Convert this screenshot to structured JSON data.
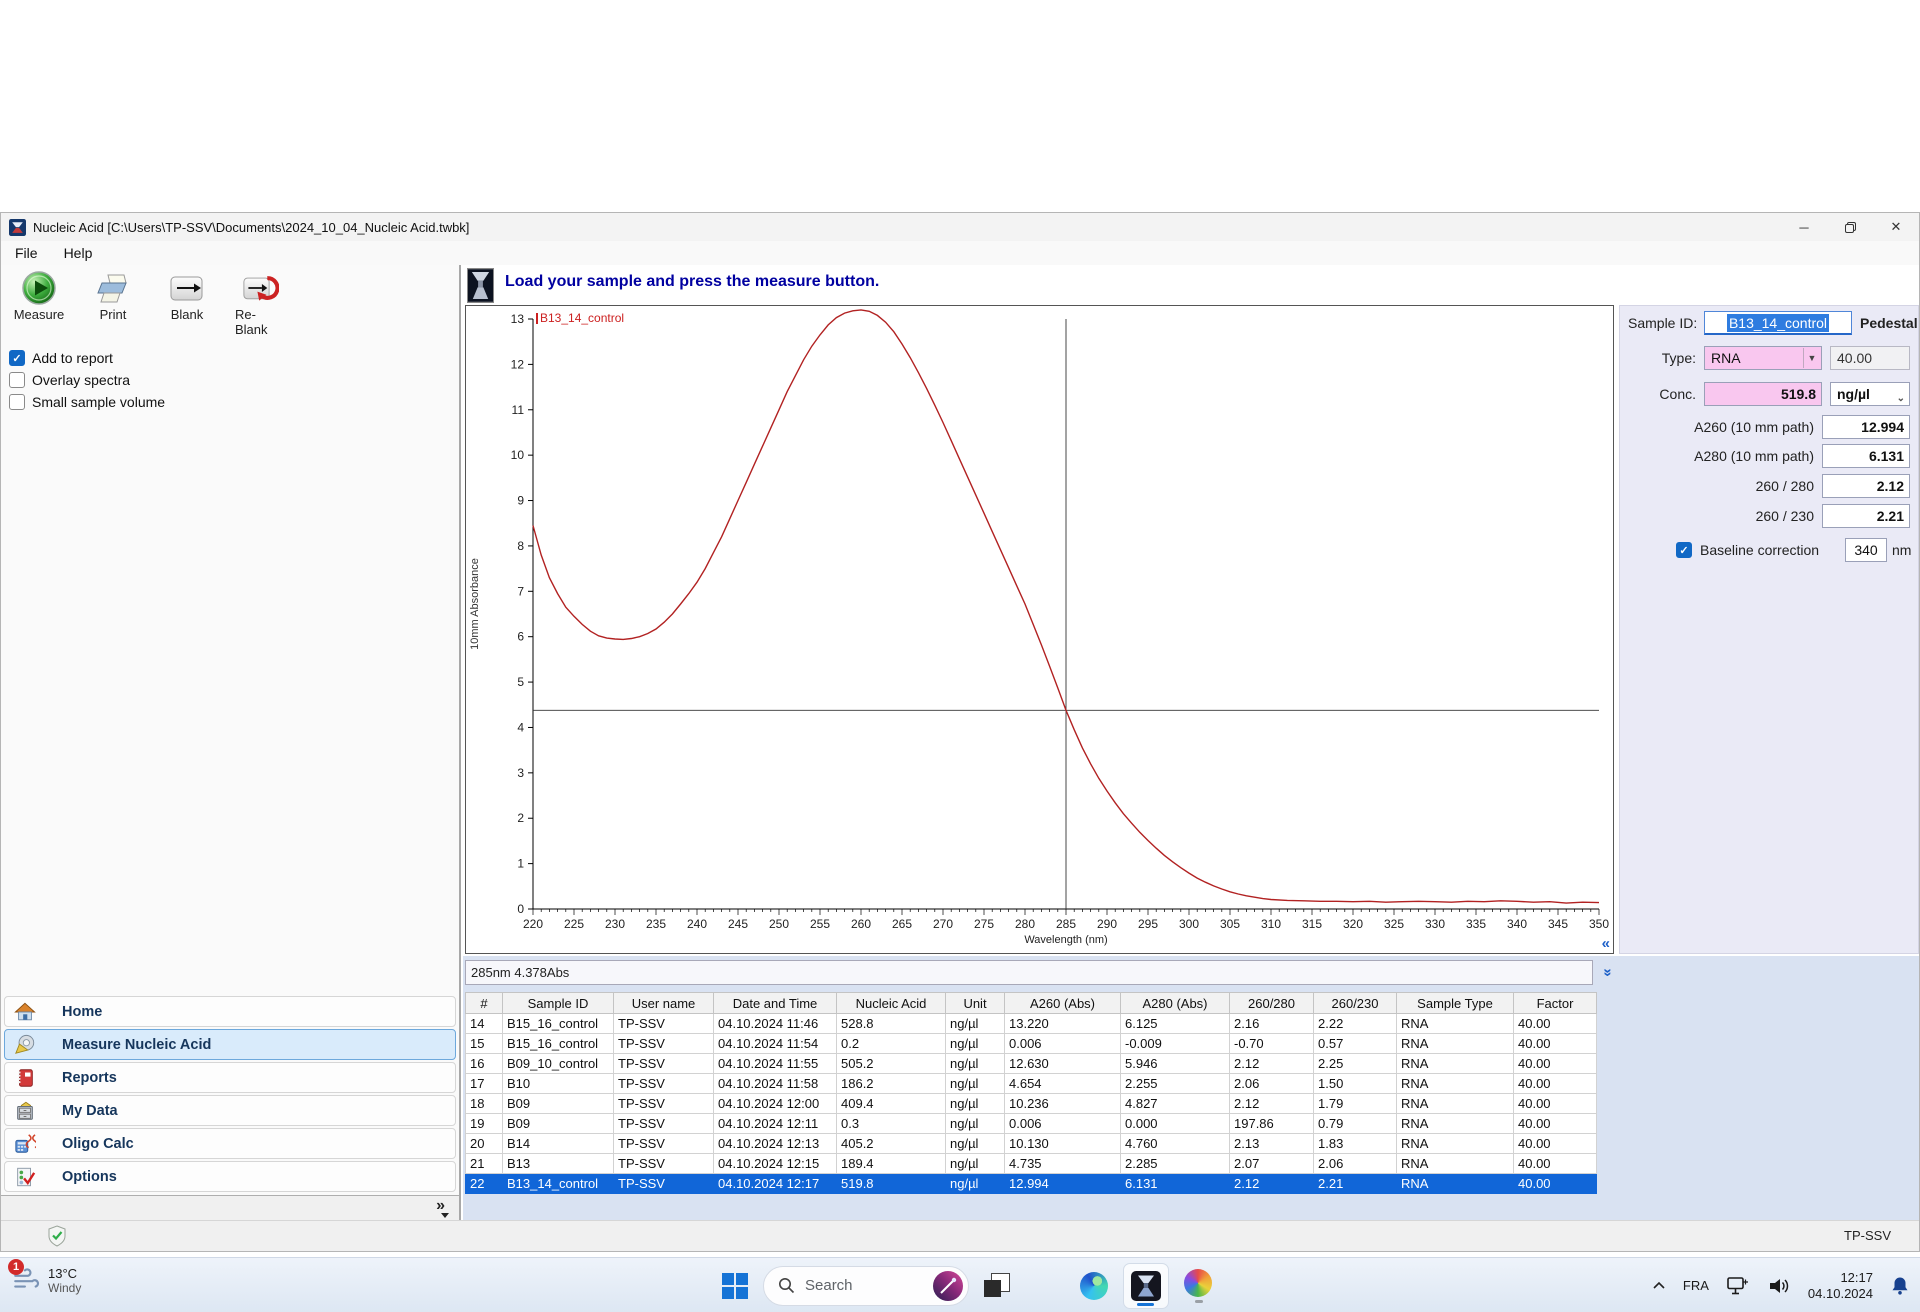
{
  "window": {
    "title": "Nucleic Acid  [C:\\Users\\TP-SSV\\Documents\\2024_10_04_Nucleic Acid.twbk]",
    "menu": [
      "File",
      "Help"
    ]
  },
  "toolbar": {
    "measure": "Measure",
    "print": "Print",
    "blank": "Blank",
    "reblank": "Re-Blank"
  },
  "checkboxes": [
    {
      "label": "Add to report",
      "checked": true
    },
    {
      "label": "Overlay spectra",
      "checked": false
    },
    {
      "label": "Small sample volume",
      "checked": false
    }
  ],
  "sidebar": {
    "items": [
      {
        "label": "Home",
        "selected": false
      },
      {
        "label": "Measure Nucleic Acid",
        "selected": true
      },
      {
        "label": "Reports",
        "selected": false
      },
      {
        "label": "My Data",
        "selected": false
      },
      {
        "label": "Oligo Calc",
        "selected": false
      },
      {
        "label": "Options",
        "selected": false
      }
    ],
    "collapse_glyph": "»"
  },
  "message_bar": {
    "text": "Load your sample and press the measure button."
  },
  "chart_data": {
    "type": "line",
    "title": "",
    "xlabel": "Wavelength (nm)",
    "ylabel": "10mm Absorbance",
    "xlim": [
      220,
      350
    ],
    "ylim": [
      0,
      13
    ],
    "x_ticks": [
      220,
      225,
      230,
      235,
      240,
      245,
      250,
      255,
      260,
      265,
      270,
      275,
      280,
      285,
      290,
      295,
      300,
      305,
      310,
      315,
      320,
      325,
      330,
      335,
      340,
      345,
      350
    ],
    "y_ticks": [
      0,
      1,
      2,
      3,
      4,
      5,
      6,
      7,
      8,
      9,
      10,
      11,
      12,
      13
    ],
    "grid": false,
    "legend_position": "top-left",
    "crosshair": {
      "x": 285,
      "y": 4.378
    },
    "series": [
      {
        "name": "B13_14_control",
        "color": "#b22222",
        "points": [
          [
            220,
            8.45
          ],
          [
            221,
            7.8
          ],
          [
            222,
            7.3
          ],
          [
            223,
            6.95
          ],
          [
            224,
            6.65
          ],
          [
            225,
            6.45
          ],
          [
            226,
            6.27
          ],
          [
            227,
            6.12
          ],
          [
            228,
            6.02
          ],
          [
            229,
            5.97
          ],
          [
            230,
            5.95
          ],
          [
            231,
            5.94
          ],
          [
            232,
            5.96
          ],
          [
            233,
            6.0
          ],
          [
            234,
            6.07
          ],
          [
            235,
            6.17
          ],
          [
            236,
            6.32
          ],
          [
            237,
            6.5
          ],
          [
            238,
            6.72
          ],
          [
            239,
            6.95
          ],
          [
            240,
            7.2
          ],
          [
            241,
            7.5
          ],
          [
            242,
            7.85
          ],
          [
            243,
            8.2
          ],
          [
            244,
            8.6
          ],
          [
            245,
            9.0
          ],
          [
            246,
            9.4
          ],
          [
            247,
            9.8
          ],
          [
            248,
            10.2
          ],
          [
            249,
            10.6
          ],
          [
            250,
            11.0
          ],
          [
            251,
            11.4
          ],
          [
            252,
            11.75
          ],
          [
            253,
            12.1
          ],
          [
            254,
            12.4
          ],
          [
            255,
            12.65
          ],
          [
            256,
            12.87
          ],
          [
            257,
            13.03
          ],
          [
            258,
            13.13
          ],
          [
            259,
            13.18
          ],
          [
            260,
            13.2
          ],
          [
            261,
            13.17
          ],
          [
            262,
            13.08
          ],
          [
            263,
            12.93
          ],
          [
            264,
            12.72
          ],
          [
            265,
            12.45
          ],
          [
            266,
            12.15
          ],
          [
            267,
            11.82
          ],
          [
            268,
            11.47
          ],
          [
            269,
            11.1
          ],
          [
            270,
            10.72
          ],
          [
            271,
            10.32
          ],
          [
            272,
            9.92
          ],
          [
            273,
            9.52
          ],
          [
            274,
            9.12
          ],
          [
            275,
            8.72
          ],
          [
            276,
            8.32
          ],
          [
            277,
            7.92
          ],
          [
            278,
            7.52
          ],
          [
            279,
            7.12
          ],
          [
            280,
            6.72
          ],
          [
            281,
            6.27
          ],
          [
            282,
            5.82
          ],
          [
            283,
            5.35
          ],
          [
            284,
            4.87
          ],
          [
            285,
            4.378
          ],
          [
            286,
            3.95
          ],
          [
            287,
            3.55
          ],
          [
            288,
            3.2
          ],
          [
            289,
            2.88
          ],
          [
            290,
            2.6
          ],
          [
            291,
            2.34
          ],
          [
            292,
            2.1
          ],
          [
            293,
            1.89
          ],
          [
            294,
            1.69
          ],
          [
            295,
            1.51
          ],
          [
            296,
            1.34
          ],
          [
            297,
            1.18
          ],
          [
            298,
            1.04
          ],
          [
            299,
            0.91
          ],
          [
            300,
            0.79
          ],
          [
            301,
            0.68
          ],
          [
            302,
            0.59
          ],
          [
            303,
            0.51
          ],
          [
            304,
            0.44
          ],
          [
            305,
            0.38
          ],
          [
            306,
            0.33
          ],
          [
            307,
            0.29
          ],
          [
            308,
            0.26
          ],
          [
            309,
            0.23
          ],
          [
            310,
            0.21
          ],
          [
            312,
            0.19
          ],
          [
            314,
            0.18
          ],
          [
            316,
            0.17
          ],
          [
            318,
            0.17
          ],
          [
            320,
            0.16
          ],
          [
            322,
            0.17
          ],
          [
            324,
            0.15
          ],
          [
            326,
            0.16
          ],
          [
            328,
            0.17
          ],
          [
            330,
            0.16
          ],
          [
            332,
            0.15
          ],
          [
            334,
            0.17
          ],
          [
            336,
            0.16
          ],
          [
            338,
            0.18
          ],
          [
            340,
            0.17
          ],
          [
            342,
            0.15
          ],
          [
            344,
            0.16
          ],
          [
            346,
            0.13
          ],
          [
            348,
            0.15
          ],
          [
            350,
            0.14
          ]
        ]
      }
    ]
  },
  "status_readout": "285nm 4.378Abs",
  "info_panel": {
    "sample_id_label": "Sample ID:",
    "sample_id_value": "B13_14_control",
    "mode_label": "Pedestal",
    "type_label": "Type:",
    "type_value": "RNA",
    "factor_value": "40.00",
    "conc_label": "Conc.",
    "conc_value": "519.8",
    "conc_unit": "ng/µl",
    "rows": [
      {
        "label": "A260 (10 mm path)",
        "value": "12.994"
      },
      {
        "label": "A280 (10 mm path)",
        "value": "6.131"
      },
      {
        "label": "260 / 280",
        "value": "2.12"
      },
      {
        "label": "260 / 230",
        "value": "2.21"
      }
    ],
    "baseline": {
      "label": "Baseline correction",
      "value": "340",
      "unit": "nm",
      "checked": true
    }
  },
  "table": {
    "columns": [
      "#",
      "Sample ID",
      "User name",
      "Date and Time",
      "Nucleic Acid",
      "Unit",
      "A260 (Abs)",
      "A280 (Abs)",
      "260/280",
      "260/230",
      "Sample Type",
      "Factor"
    ],
    "rows": [
      [
        "14",
        "B15_16_control",
        "TP-SSV",
        "04.10.2024 11:46",
        "528.8",
        "ng/µl",
        "13.220",
        "6.125",
        "2.16",
        "2.22",
        "RNA",
        "40.00"
      ],
      [
        "15",
        "B15_16_control",
        "TP-SSV",
        "04.10.2024 11:54",
        "0.2",
        "ng/µl",
        "0.006",
        "-0.009",
        "-0.70",
        "0.57",
        "RNA",
        "40.00"
      ],
      [
        "16",
        "B09_10_control",
        "TP-SSV",
        "04.10.2024 11:55",
        "505.2",
        "ng/µl",
        "12.630",
        "5.946",
        "2.12",
        "2.25",
        "RNA",
        "40.00"
      ],
      [
        "17",
        "B10",
        "TP-SSV",
        "04.10.2024 11:58",
        "186.2",
        "ng/µl",
        "4.654",
        "2.255",
        "2.06",
        "1.50",
        "RNA",
        "40.00"
      ],
      [
        "18",
        "B09",
        "TP-SSV",
        "04.10.2024 12:00",
        "409.4",
        "ng/µl",
        "10.236",
        "4.827",
        "2.12",
        "1.79",
        "RNA",
        "40.00"
      ],
      [
        "19",
        "B09",
        "TP-SSV",
        "04.10.2024 12:11",
        "0.3",
        "ng/µl",
        "0.006",
        "0.000",
        "197.86",
        "0.79",
        "RNA",
        "40.00"
      ],
      [
        "20",
        "B14",
        "TP-SSV",
        "04.10.2024 12:13",
        "405.2",
        "ng/µl",
        "10.130",
        "4.760",
        "2.13",
        "1.83",
        "RNA",
        "40.00"
      ],
      [
        "21",
        "B13",
        "TP-SSV",
        "04.10.2024 12:15",
        "189.4",
        "ng/µl",
        "4.735",
        "2.285",
        "2.07",
        "2.06",
        "RNA",
        "40.00"
      ],
      [
        "22",
        "B13_14_control",
        "TP-SSV",
        "04.10.2024 12:17",
        "519.8",
        "ng/µl",
        "12.994",
        "6.131",
        "2.12",
        "2.21",
        "RNA",
        "40.00"
      ]
    ],
    "selected_row_index": 8
  },
  "app_statusbar": {
    "user": "TP-SSV"
  },
  "taskbar": {
    "weather": {
      "temp": "13°C",
      "condition": "Windy",
      "badge": "1"
    },
    "search_placeholder": "Search",
    "tray": {
      "language": "FRA",
      "time": "12:17",
      "date": "04.10.2024"
    }
  },
  "colors": {
    "selection_blue": "#1166d8",
    "curve_red": "#b22222",
    "pink_field": "#f9c7ef",
    "message_blue": "#0000a0",
    "sidebar_selected": "#d9ebfb"
  }
}
